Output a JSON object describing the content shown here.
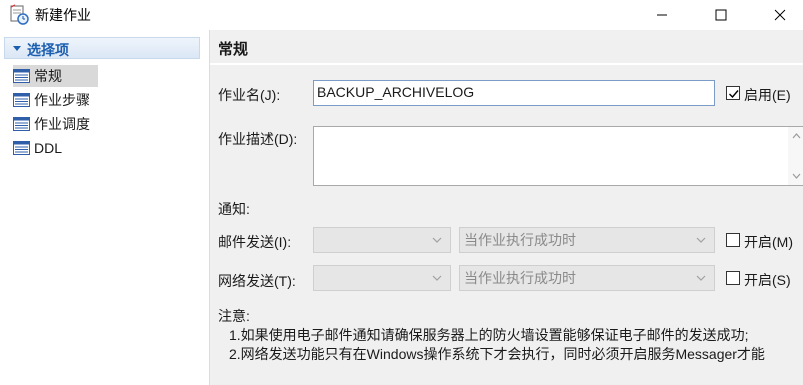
{
  "window": {
    "title": "新建作业"
  },
  "sidebar": {
    "header": "选择项",
    "items": [
      {
        "label": "常规",
        "selected": true
      },
      {
        "label": "作业步骤",
        "selected": false
      },
      {
        "label": "作业调度",
        "selected": false
      },
      {
        "label": "DDL",
        "selected": false
      }
    ]
  },
  "general": {
    "section_title": "常规",
    "job_name_label": "作业名(J):",
    "job_name_value": "BACKUP_ARCHIVELOG",
    "enabled_label": "启用(E)",
    "enabled_checked": true,
    "job_desc_label": "作业描述(D):",
    "job_desc_value": "",
    "notify_label": "通知:",
    "mail_label": "邮件发送(I):",
    "mail_combo1_value": "",
    "mail_combo2_value": "当作业执行成功时",
    "mail_enable_label": "开启(M)",
    "mail_enable_checked": false,
    "net_label": "网络发送(T):",
    "net_combo1_value": "",
    "net_combo2_value": "当作业执行成功时",
    "net_enable_label": "开启(S)",
    "net_enable_checked": false,
    "notes_title": "注意:",
    "note1": "1.如果使用电子邮件通知请确保服务器上的防火墙设置能够保证电子邮件的发送成功;",
    "note2": "2.网络发送功能只有在Windows操作系统下才会执行，同时必须开启服务Messager才能"
  },
  "colors": {
    "accent": "#1c5fb0",
    "panel_bg": "#f0f0f0",
    "disabled_combo": "#e6e6e6"
  }
}
